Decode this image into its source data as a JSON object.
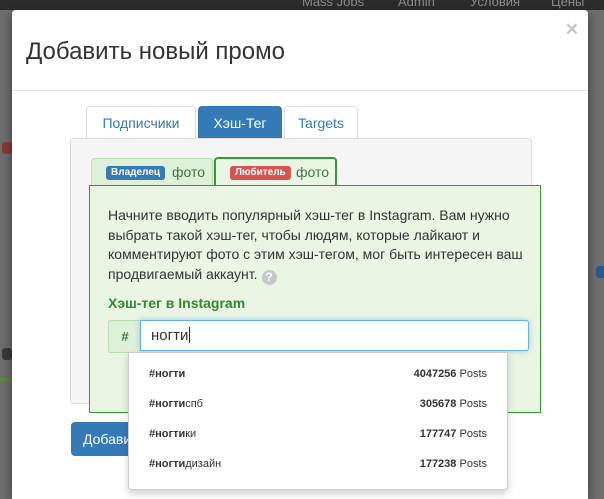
{
  "background": {
    "nav_items": [
      "Mass Jobs",
      "Admin",
      "Условия",
      "Цены"
    ]
  },
  "modal": {
    "title": "Добавить новый промо",
    "close_glyph": "×"
  },
  "tabs": [
    {
      "label": "Подписчики",
      "active": false
    },
    {
      "label": "Хэш-Тег",
      "active": true
    },
    {
      "label": "Targets",
      "active": false
    }
  ],
  "subtabs": [
    {
      "badge": "Владелец",
      "badge_color": "#337ab7",
      "word": "фото",
      "active": false
    },
    {
      "badge": "Любитель",
      "badge_color": "#d9534f",
      "word": "фото",
      "active": true
    }
  ],
  "description": "Начните вводить популярный хэш-тег в Instagram. Вам нужно выбрать такой хэш-тег, чтобы людям, которые лайкают и комментируют фото с этим хэш-тегом, мог быть интересен ваш продвигаемый аккаунт.",
  "help_glyph": "?",
  "field": {
    "label": "Хэш-тег в Instagram",
    "addon": "#",
    "value": "ногти"
  },
  "add_button": "Добави",
  "suggestions": [
    {
      "prefix": "#ногти",
      "suffix": "",
      "count": "4047256",
      "unit": "Posts"
    },
    {
      "prefix": "#ногти",
      "suffix": "спб",
      "count": "305678",
      "unit": "Posts"
    },
    {
      "prefix": "#ногти",
      "suffix": "ки",
      "count": "177747",
      "unit": "Posts"
    },
    {
      "prefix": "#ногти",
      "suffix": "дизайн",
      "count": "177238",
      "unit": "Posts"
    }
  ],
  "colors": {
    "primary": "#337ab7",
    "success_text": "#3c763d",
    "success_border": "#2e9e2e",
    "danger": "#d9534f"
  }
}
